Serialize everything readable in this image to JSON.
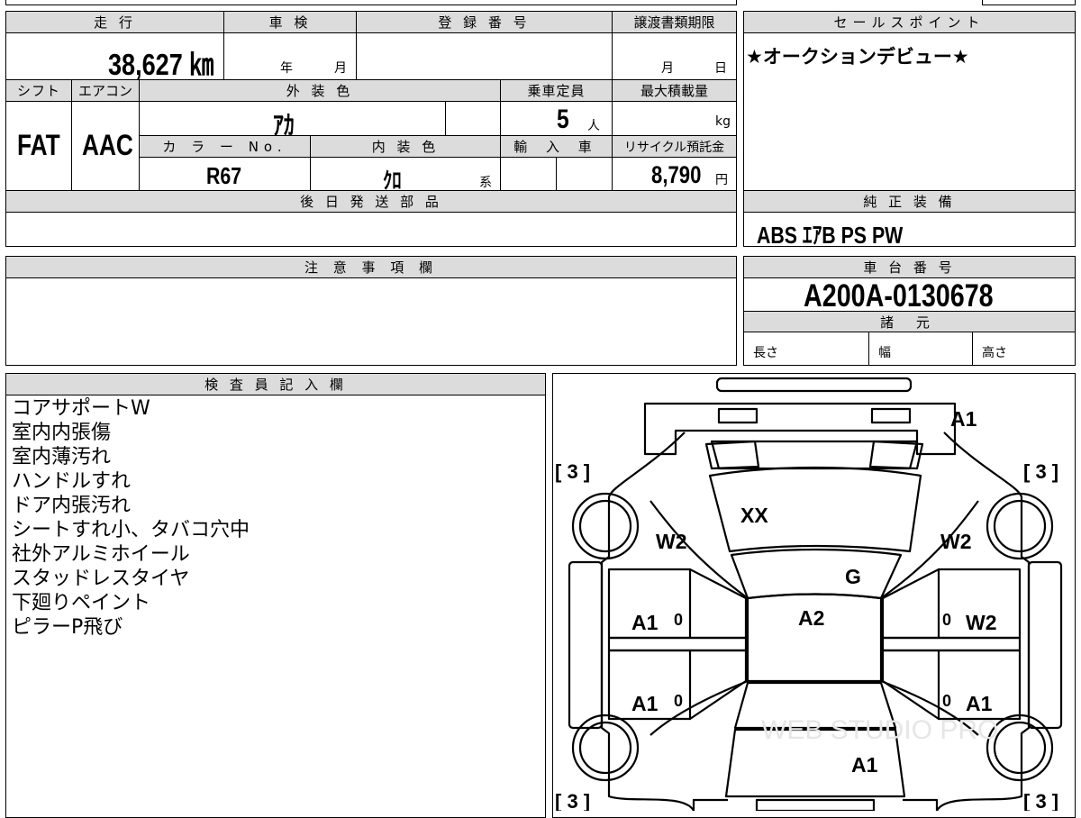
{
  "mileage": {
    "label": "走 行",
    "value": "38,627 ㎞"
  },
  "shaken": {
    "label": "車 検",
    "year": "年",
    "month": "月"
  },
  "registration": {
    "label": "登 録 番 号"
  },
  "transfer_deadline": {
    "label": "譲渡書類期限",
    "month": "月",
    "day": "日"
  },
  "sales_point": {
    "label": "セールスポイント",
    "text": "★オークションデビュー★"
  },
  "shift": {
    "label": "シフト",
    "value": "FAT"
  },
  "aircon": {
    "label": "エアコン",
    "value": "AAC"
  },
  "exterior_color": {
    "label": "外 装 色",
    "value": "ｱｶ"
  },
  "capacity": {
    "label": "乗車定員",
    "value": "5",
    "unit": "人"
  },
  "max_load": {
    "label": "最大積載量",
    "unit": "kg"
  },
  "color_no": {
    "label": "カ ラ ー No.",
    "value": "R67"
  },
  "interior_color": {
    "label": "内 装 色",
    "value": "ｸﾛ",
    "suffix": "系"
  },
  "import": {
    "label": "輸 入 車"
  },
  "recycle": {
    "label": "リサイクル預託金",
    "value": "8,790",
    "unit": "円"
  },
  "later_parts": {
    "label": "後 日 発 送 部 品"
  },
  "equipment": {
    "label": "純 正 装 備",
    "value": "ABS ｴｱB PS PW"
  },
  "notes": {
    "label": "注 意 事 項 欄"
  },
  "chassis": {
    "label": "車 台 番 号",
    "value": "A200A-0130678"
  },
  "specs": {
    "label": "諸 元",
    "length": "長さ",
    "width": "幅",
    "height": "高さ"
  },
  "inspector": {
    "label": "検 査 員 記 入 欄",
    "lines": [
      "コアサポートW",
      "室内内張傷",
      "室内薄汚れ",
      "ハンドルすれ",
      "ドア内張汚れ",
      "シートすれ小、タバコ穴中",
      "社外アルミホイール",
      "スタッドレスタイヤ",
      "下廻りペイント",
      "ピラーP飛び"
    ]
  },
  "diagram": {
    "marks": {
      "front_bumper": "A1",
      "hood": "XX",
      "left_front_fender": "W2",
      "right_front_fender": "W2",
      "windshield": "G",
      "roof": "A2",
      "left_front_door": "A1",
      "left_front_door_zero": "0",
      "right_front_door_zero": "0",
      "right_front_door": "W2",
      "left_rear_door": "A1",
      "left_rear_door_zero": "0",
      "right_rear_door_zero": "0",
      "right_rear_door": "A1",
      "trunk": "A1"
    },
    "tire_treads": [
      "[ 3 ]",
      "[ 3 ]",
      "[ 3 ]",
      "[ 3 ]"
    ],
    "watermark": "WEB STUDIO PRO"
  }
}
